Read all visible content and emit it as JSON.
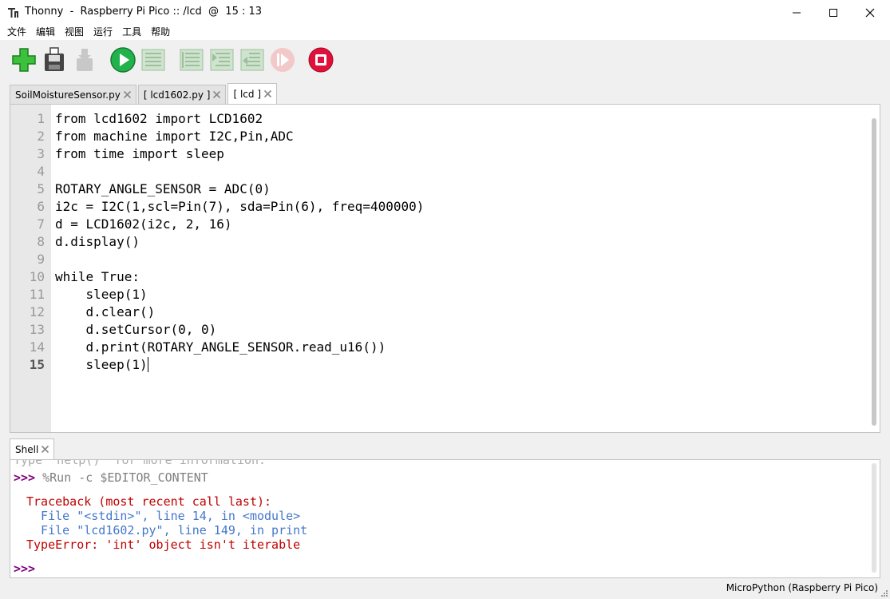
{
  "window": {
    "title": "Thonny  -  Raspberry Pi Pico :: /lcd  @  15 : 13"
  },
  "menu": [
    "文件",
    "编辑",
    "视图",
    "运行",
    "工具",
    "帮助"
  ],
  "toolbar": [
    "new-file-icon",
    "save-icon",
    "download-icon",
    "run-icon",
    "debug-icon",
    "step-over-icon",
    "step-into-icon",
    "step-out-icon",
    "resume-icon",
    "stop-icon"
  ],
  "tabs": [
    {
      "label": "SoilMoistureSensor.py"
    },
    {
      "label": "[ lcd1602.py ]"
    },
    {
      "label": "[ lcd ]",
      "active": true
    }
  ],
  "editor": {
    "line_numbers": [
      "1",
      "2",
      "3",
      "4",
      "5",
      "6",
      "7",
      "8",
      "9",
      "10",
      "11",
      "12",
      "13",
      "14",
      "15"
    ],
    "lines": [
      "from lcd1602 import LCD1602",
      "from machine import I2C,Pin,ADC",
      "from time import sleep",
      "",
      "ROTARY_ANGLE_SENSOR = ADC(0)",
      "i2c = I2C(1,scl=Pin(7), sda=Pin(6), freq=400000)",
      "d = LCD1602(i2c, 2, 16)",
      "d.display()",
      "",
      "while True:",
      "    sleep(1)",
      "    d.clear()",
      "    d.setCursor(0, 0)",
      "    d.print(ROTARY_ANGLE_SENSOR.read_u16())",
      "    sleep(1)"
    ]
  },
  "shell": {
    "tab_label": "Shell",
    "faded_line": "Type \"help()\" for more information.",
    "prompt": ">>>",
    "command": " %Run -c $EDITOR_CONTENT",
    "traceback_header": "Traceback (most recent call last):",
    "traceback_frames": [
      "  File \"<stdin>\", line 14, in <module>",
      "  File \"lcd1602.py\", line 149, in print"
    ],
    "error": "TypeError: 'int' object isn't iterable",
    "final_prompt": ">>>"
  },
  "status": {
    "interpreter": "MicroPython (Raspberry Pi Pico)"
  }
}
